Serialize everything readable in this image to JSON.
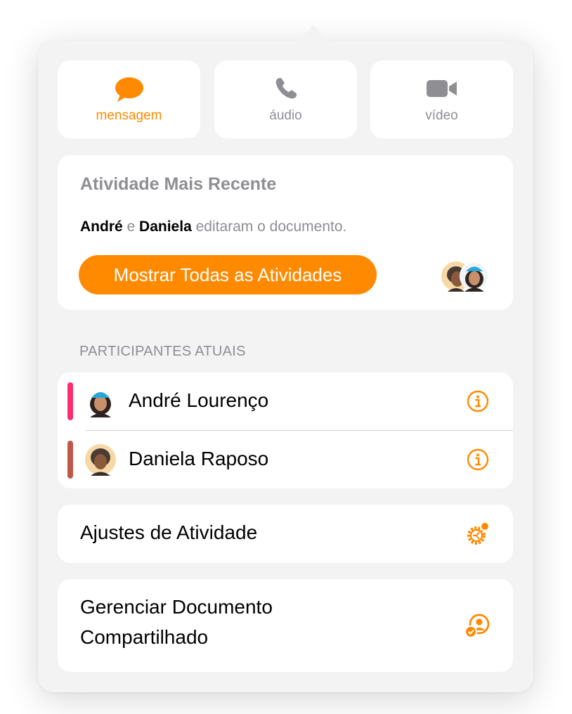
{
  "contact": {
    "buttons": [
      {
        "label": "mensagem",
        "icon": "message-bubble-icon",
        "active": true
      },
      {
        "label": "áudio",
        "icon": "phone-icon",
        "active": false
      },
      {
        "label": "vídeo",
        "icon": "video-camera-icon",
        "active": false
      }
    ]
  },
  "recent_activity": {
    "title": "Atividade Mais Recente",
    "name1": "André",
    "conj": " e ",
    "name2": "Daniela",
    "suffix": " editaram o documento.",
    "button_label": "Mostrar Todas as Atividades"
  },
  "participants": {
    "header": "PARTICIPANTES ATUAIS",
    "items": [
      {
        "name": "André Lourenço",
        "color": "#ff2d6f",
        "avatar": "memoji-teal-cap"
      },
      {
        "name": "Daniela Raposo",
        "color": "#c0584a",
        "avatar": "memoji-dark-hair"
      }
    ]
  },
  "menu": {
    "activity_settings": "Ajustes de Atividade",
    "manage_line1": "Gerenciar Documento",
    "manage_line2": "Compartilhado"
  },
  "colors": {
    "accent": "#ff8a00",
    "secondary_text": "#8e8e93",
    "background": "#f3f3f4"
  }
}
